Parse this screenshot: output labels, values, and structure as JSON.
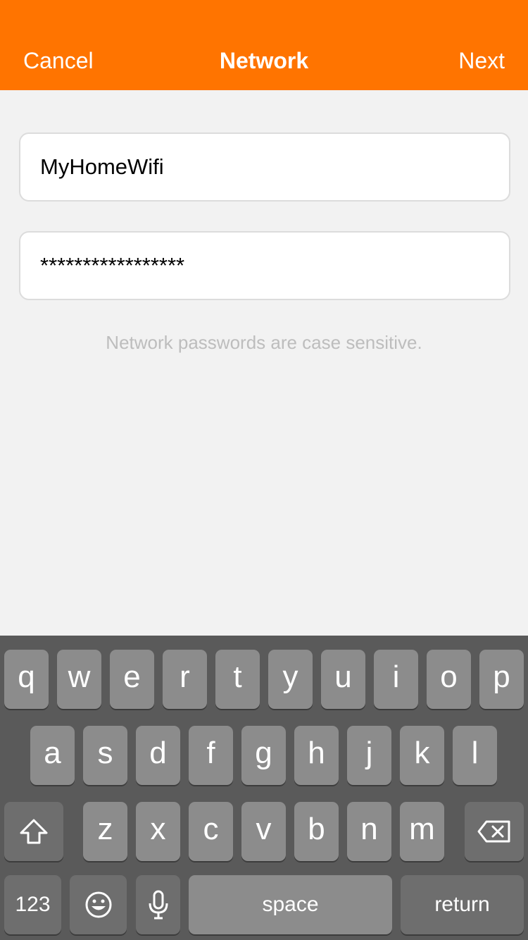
{
  "navbar": {
    "cancel_label": "Cancel",
    "title": "Network",
    "next_label": "Next",
    "background": "#ff7400"
  },
  "form": {
    "ssid_value": "MyHomeWifi",
    "password_value": "*****************",
    "hint": "Network passwords are case sensitive."
  },
  "keyboard": {
    "row1": [
      "q",
      "w",
      "e",
      "r",
      "t",
      "y",
      "u",
      "i",
      "o",
      "p"
    ],
    "row2": [
      "a",
      "s",
      "d",
      "f",
      "g",
      "h",
      "j",
      "k",
      "l"
    ],
    "row3": [
      "z",
      "x",
      "c",
      "v",
      "b",
      "n",
      "m"
    ],
    "numbers_label": "123",
    "space_label": "space",
    "return_label": "return",
    "icons": {
      "shift": "shift-icon",
      "delete": "backspace-icon",
      "emoji": "emoji-icon",
      "dictation": "microphone-icon"
    }
  }
}
